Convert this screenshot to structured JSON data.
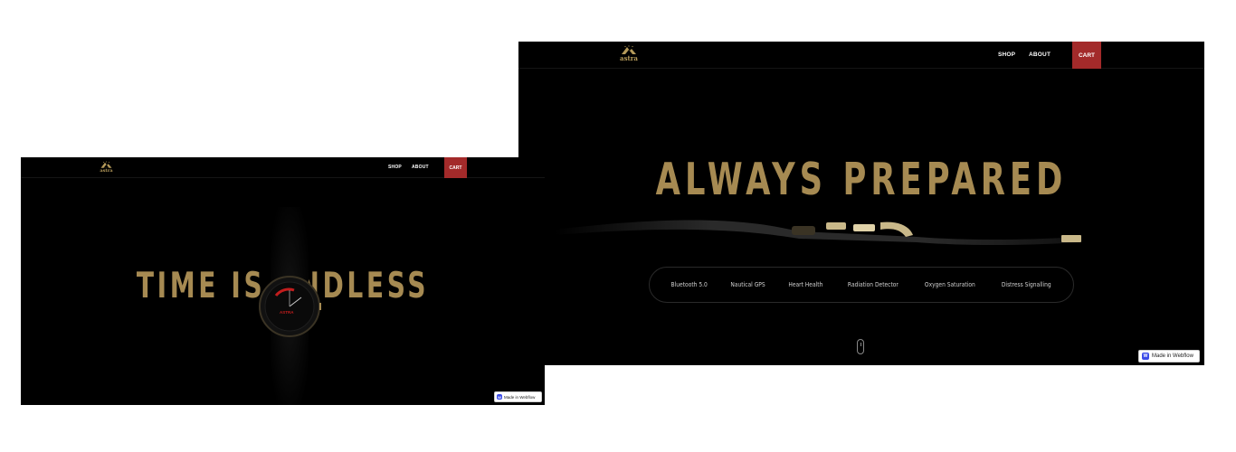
{
  "brand": {
    "name": "astra",
    "gold_color": "#a68a52",
    "cart_color": "#a32a2a"
  },
  "nav": {
    "shop_label": "SHOP",
    "about_label": "ABOUT",
    "cart_label": "CART"
  },
  "back_screen": {
    "headline": "ALWAYS PREPARED",
    "features": [
      "Bluetooth 5.0",
      "Nautical GPS",
      "Heart Health",
      "Radiation Detector",
      "Oxygen Saturation",
      "Distress Signalling"
    ]
  },
  "front_screen": {
    "headline": "TIME IS ENDLESS",
    "watch_dial_text": "ASTRA"
  },
  "badge": {
    "label": "Made in Webflow",
    "icon_letter": "W"
  }
}
